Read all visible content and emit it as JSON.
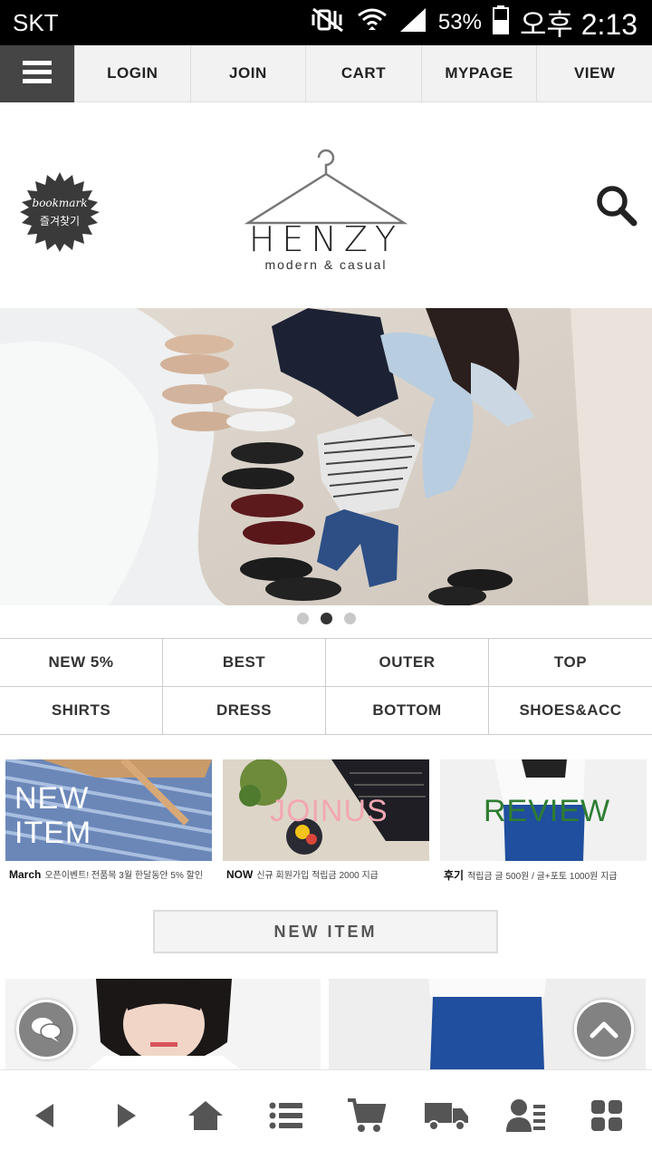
{
  "status_bar": {
    "carrier": "SKT",
    "battery": "53%",
    "time": "오후 2:13"
  },
  "top_nav": {
    "items": [
      "LOGIN",
      "JOIN",
      "CART",
      "MYPAGE",
      "VIEW"
    ]
  },
  "header": {
    "bookmark_en": "bookmark",
    "bookmark_kr": "즐겨찾기",
    "brand": "HENZY",
    "tagline": "modern & casual"
  },
  "slider": {
    "slide_count": 3,
    "active_slide": 2
  },
  "categories": [
    "NEW 5%",
    "BEST",
    "OUTER",
    "TOP",
    "SHIRTS",
    "DRESS",
    "BOTTOM",
    "SHOES&ACC"
  ],
  "banners": [
    {
      "overlay_line1": "NEW",
      "overlay_line2": "ITEM",
      "cap_bold": "March",
      "cap_text": "오픈이벤트! 전품목 3월 한달동안 5% 할인"
    },
    {
      "overlay_line1": "JOINUS",
      "overlay_line2": "",
      "cap_bold": "NOW",
      "cap_text": "신규 회원가입 적립금 2000 지급"
    },
    {
      "overlay_line1": "REVIEW",
      "overlay_line2": "",
      "cap_bold": "후기",
      "cap_text": "적립금 글 500원 / 글+포토 1000원 지급"
    }
  ],
  "new_item_button": "NEW ITEM",
  "icons": {
    "menu": "hamburger-icon",
    "search": "search-icon",
    "chat": "chat-icon",
    "scroll_top": "chevron-up-icon",
    "toolbar": [
      "back-arrow-icon",
      "forward-arrow-icon",
      "home-icon",
      "list-icon",
      "cart-icon",
      "delivery-truck-icon",
      "user-icon",
      "grid-icon"
    ]
  },
  "colors": {
    "status_bar": "#000000",
    "menu_button": "#454545",
    "nav_bg": "#f2f2f2",
    "review_text": "#2e7d32",
    "joinus_text": "#f2a7b3"
  }
}
